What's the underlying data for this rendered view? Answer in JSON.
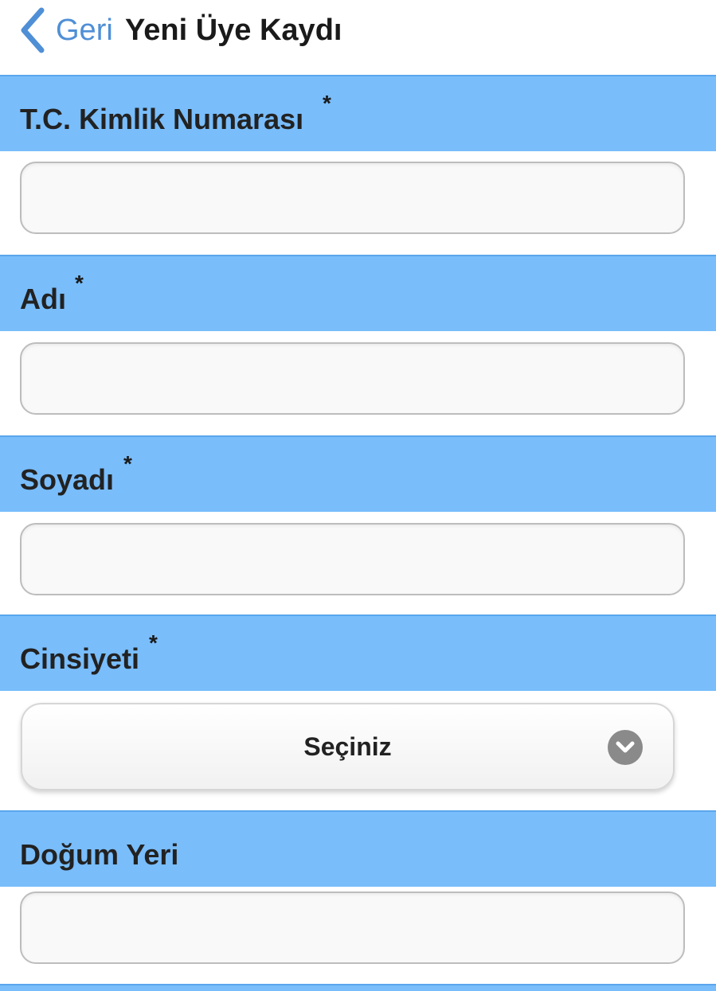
{
  "header": {
    "back_label": "Geri",
    "title": "Yeni Üye Kaydı"
  },
  "form": {
    "tc_kimlik": {
      "label": "T.C. Kimlik Numarası",
      "required_mark": "*",
      "value": ""
    },
    "adi": {
      "label": "Adı",
      "required_mark": "*",
      "value": ""
    },
    "soyadi": {
      "label": "Soyadı",
      "required_mark": "*",
      "value": ""
    },
    "cinsiyeti": {
      "label": "Cinsiyeti",
      "required_mark": "*",
      "selected": "Seçiniz"
    },
    "dogum_yeri": {
      "label": "Doğum Yeri",
      "value": ""
    }
  },
  "colors": {
    "section_band": "#79bdfb",
    "back_link": "#4f8fd6",
    "input_border": "#bdbdbd"
  },
  "icons": {
    "back": "chevron-left-icon",
    "select": "chevron-down-circle-icon"
  }
}
